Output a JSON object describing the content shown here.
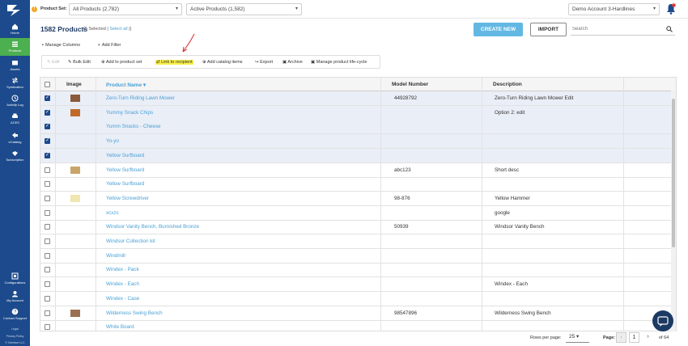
{
  "sidebar": {
    "items": [
      {
        "label": "Home",
        "icon": "home-icon"
      },
      {
        "label": "Products",
        "icon": "products-icon",
        "active": true
      },
      {
        "label": "Assets",
        "icon": "assets-icon"
      },
      {
        "label": "Syndication",
        "icon": "syndication-icon"
      },
      {
        "label": "Activity Log",
        "icon": "activity-log-icon"
      },
      {
        "label": "ACES",
        "icon": "car-icon"
      },
      {
        "label": "eCatalog",
        "icon": "ecatalog-icon"
      },
      {
        "label": "Subscription",
        "icon": "subscription-icon"
      }
    ],
    "bottom_items": [
      {
        "label": "Configurations",
        "icon": "configurations-icon"
      },
      {
        "label": "My Account",
        "icon": "account-icon"
      },
      {
        "label": "Contact Support",
        "icon": "help-icon"
      }
    ],
    "legal": [
      "Legal",
      "Privacy Policy",
      "© Gembue LLC"
    ]
  },
  "topbar": {
    "product_set_label": "Product Set:",
    "product_set_value": "All Products (2,782)",
    "status_value": "Active Products (1,582)",
    "account_value": "Demo Account 3-Hardlines"
  },
  "header": {
    "title": "1582 Products",
    "selected_text": "(5 Selected",
    "select_all": "Select all",
    "close_paren": ")",
    "create_button": "CREATE NEW",
    "import_button": "IMPORT",
    "search_placeholder": "Search",
    "manage_columns": "Manage Columns",
    "add_filter": "Add Filter"
  },
  "toolbar": {
    "edit": "Edit",
    "bulk_edit": "Bulk Edit",
    "add_to_product_set": "Add to product set",
    "link_to_recipient": "Link to recipient",
    "add_catalog_items": "Add catalog items",
    "export": "Export",
    "archive": "Archive",
    "manage_lifecycle": "Manage product life-cycle"
  },
  "table": {
    "columns": {
      "image": "Image",
      "product_name": "Product Name",
      "model_number": "Model Number",
      "description": "Description"
    },
    "rows": [
      {
        "selected": true,
        "thumb": "#8a5a3a",
        "name": "Zero-Turn Riding Lawn Mower",
        "model": "44928792",
        "desc": "Zero-Turn Riding Lawn Mower Edit"
      },
      {
        "selected": true,
        "thumb": "#c06a2a",
        "name": "Yummy Snack Chips",
        "model": "",
        "desc": "Option 2: edit"
      },
      {
        "selected": true,
        "thumb": "",
        "name": "Yumm Snacks - Cheese",
        "model": "",
        "desc": ""
      },
      {
        "selected": true,
        "thumb": "",
        "name": "Yo-yo",
        "model": "",
        "desc": ""
      },
      {
        "selected": true,
        "thumb": "",
        "name": "Yellow Surfboard",
        "model": "",
        "desc": ""
      },
      {
        "selected": false,
        "thumb": "#c9a46a",
        "name": "Yellow Surfboard",
        "model": "abc123",
        "desc": "Short desc"
      },
      {
        "selected": false,
        "thumb": "",
        "name": "Yellow Surfboard",
        "model": "",
        "desc": ""
      },
      {
        "selected": false,
        "thumb": "#f0e6b0",
        "name": "Yellow Screwdriver",
        "model": "98-876",
        "desc": "Yellow Hammer"
      },
      {
        "selected": false,
        "thumb": "",
        "name": "xcxzc",
        "model": "",
        "desc": "google"
      },
      {
        "selected": false,
        "thumb": "",
        "name": "Windsor Vanity Bench, Burnished Bronze",
        "model": "50939",
        "desc": "Windsor Vanity Bench"
      },
      {
        "selected": false,
        "thumb": "",
        "name": "Windsor Collection kit",
        "model": "",
        "desc": ""
      },
      {
        "selected": false,
        "thumb": "",
        "name": "Windmill",
        "model": "",
        "desc": ""
      },
      {
        "selected": false,
        "thumb": "",
        "name": "Windex - Pack",
        "model": "",
        "desc": ""
      },
      {
        "selected": false,
        "thumb": "",
        "name": "Windex - Each",
        "model": "",
        "desc": "Windex - Each"
      },
      {
        "selected": false,
        "thumb": "",
        "name": "Windex - Case",
        "model": "",
        "desc": ""
      },
      {
        "selected": false,
        "thumb": "#9a7050",
        "name": "Wilderness Swing Bench",
        "model": "98547896",
        "desc": "Wilderness Swing Bench"
      },
      {
        "selected": false,
        "thumb": "",
        "name": "White Board",
        "model": "",
        "desc": ""
      }
    ]
  },
  "footer": {
    "rows_per_page_label": "Rows per page:",
    "rows_per_page": "25",
    "page_label": "Page:",
    "page": "1",
    "of_text": "of 64"
  },
  "colors": {
    "sidebar": "#1c4a8c",
    "active": "#4caf50",
    "accent": "#4aa0d5",
    "create": "#63b8e3"
  }
}
